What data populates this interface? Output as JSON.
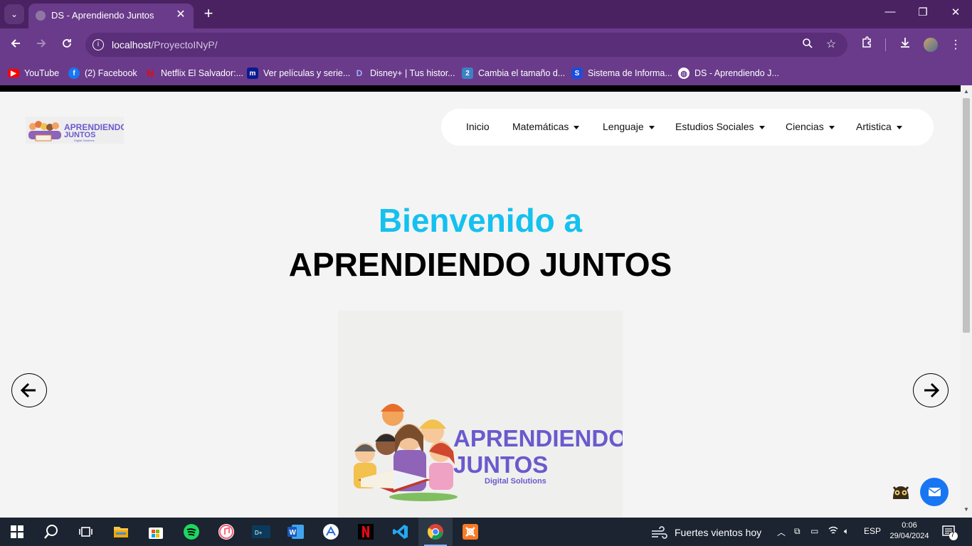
{
  "browser": {
    "tab": {
      "title": "DS - Aprendiendo Juntos",
      "close": "✕"
    },
    "new_tab": "+",
    "url": {
      "host": "localhost",
      "path": "/ProyectoINyP/"
    },
    "bookmarks": [
      {
        "label": "YouTube",
        "icon": "youtube-icon",
        "color": "#ff0000"
      },
      {
        "label": "(2) Facebook",
        "icon": "facebook-icon",
        "color": "#1877f2"
      },
      {
        "label": "Netflix El Salvador:...",
        "icon": "netflix-icon",
        "color": "#e50914"
      },
      {
        "label": "Ver películas y serie...",
        "icon": "m-icon",
        "color": "#0a1a8f"
      },
      {
        "label": "Disney+ | Tus histor...",
        "icon": "disney-icon",
        "color": "#1238c4"
      },
      {
        "label": "Cambia el tamaño d...",
        "icon": "two-icon",
        "color": "#3b82c4"
      },
      {
        "label": "Sistema de Informa...",
        "icon": "s-icon",
        "color": "#1d4ed8"
      },
      {
        "label": "DS - Aprendiendo J...",
        "icon": "globe-icon",
        "color": "#ffffff"
      }
    ]
  },
  "site": {
    "nav": {
      "items": [
        {
          "label": "Inicio",
          "dropdown": false
        },
        {
          "label": "Matemáticas",
          "dropdown": true
        },
        {
          "label": "Lenguaje",
          "dropdown": true
        },
        {
          "label": "Estudios Sociales",
          "dropdown": true
        },
        {
          "label": "Ciencias",
          "dropdown": true
        },
        {
          "label": "Artistica",
          "dropdown": true
        }
      ]
    },
    "hero": {
      "subtitle": "Bienvenido a",
      "title": "APRENDIENDO JUNTOS"
    },
    "slide_logo": {
      "line1": "APRENDIENDO",
      "line2": "JUNTOS",
      "tagline": "Digital Solutions"
    }
  },
  "taskbar": {
    "weather": "Fuertes vientos hoy",
    "lang": "ESP",
    "time": "0:06",
    "date": "29/04/2024",
    "notifications": "7"
  },
  "colors": {
    "accent": "#14c1ef",
    "chrome": "#6a3b8a",
    "mail_button": "#1976f2",
    "logo_purple": "#6a5acd"
  }
}
